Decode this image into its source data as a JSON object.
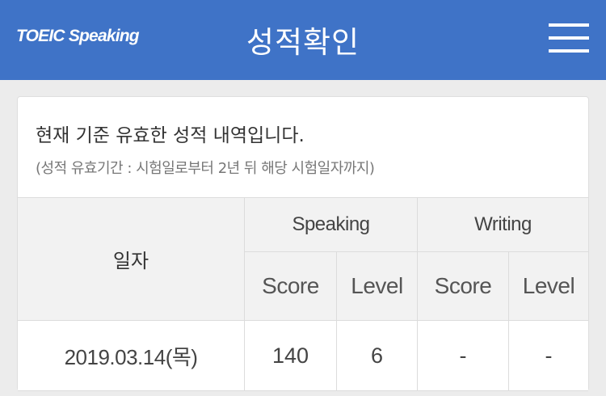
{
  "header": {
    "logo": "TOEIC Speaking",
    "title": "성적확인",
    "menu_icon": "hamburger-menu-icon"
  },
  "notice": {
    "main": "현재 기준 유효한 성적 내역입니다.",
    "sub": "(성적 유효기간 : 시험일로부터 2년 뒤 해당 시험일자까지)"
  },
  "table": {
    "date_header": "일자",
    "groups": [
      "Speaking",
      "Writing"
    ],
    "sub_headers": [
      "Score",
      "Level",
      "Score",
      "Level"
    ],
    "rows": [
      {
        "date": "2019.03.14(목)",
        "speaking_score": "140",
        "speaking_level": "6",
        "writing_score": "-",
        "writing_level": "-"
      }
    ]
  },
  "colors": {
    "header_bg": "#3f73c7",
    "page_bg": "#ececec",
    "table_head_bg": "#f2f2f2"
  }
}
